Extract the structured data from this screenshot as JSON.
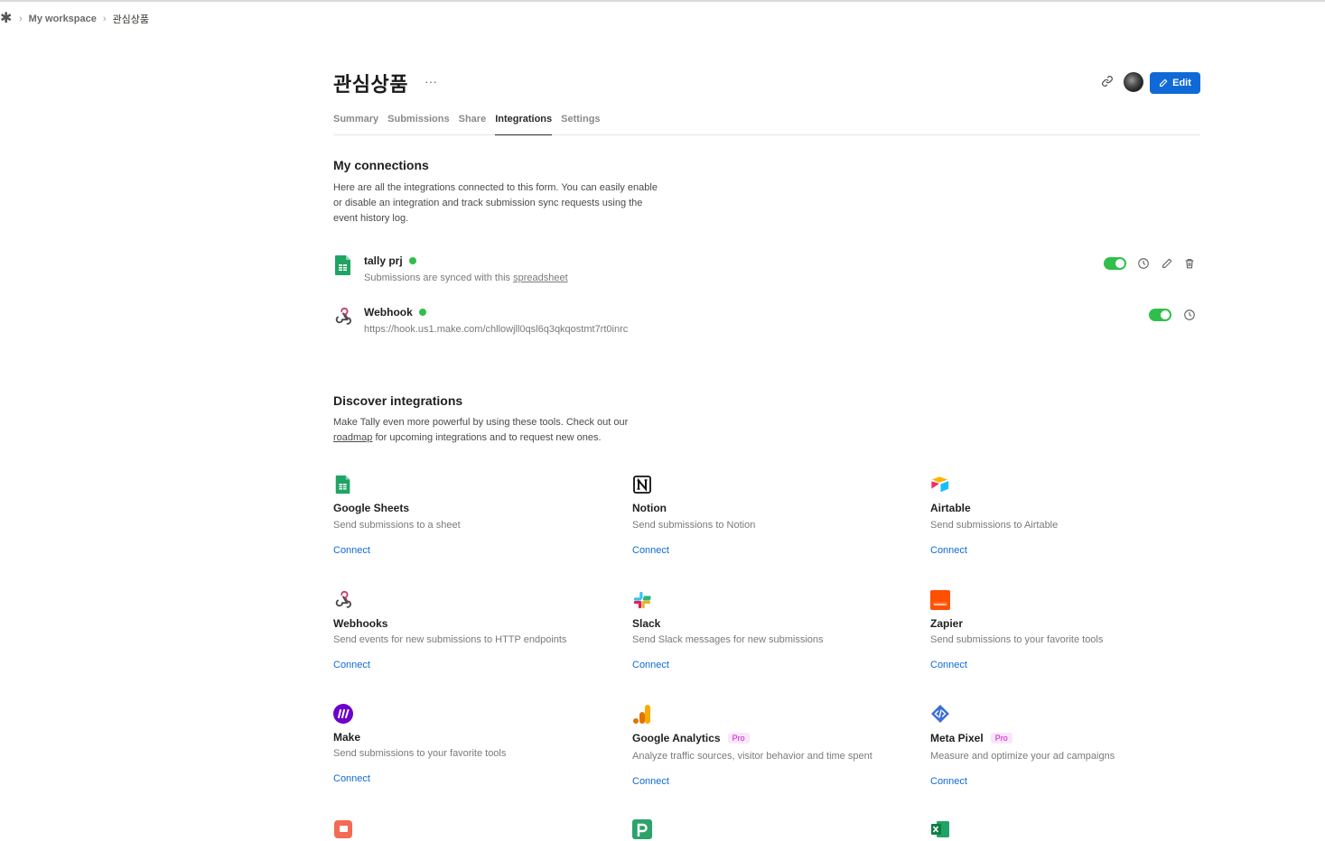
{
  "breadcrumb": {
    "workspace": "My workspace",
    "current": "관심상품"
  },
  "header": {
    "title": "관심상품",
    "more": "···",
    "edit_label": "Edit"
  },
  "tabs": [
    {
      "label": "Summary"
    },
    {
      "label": "Submissions"
    },
    {
      "label": "Share"
    },
    {
      "label": "Integrations",
      "active": true
    },
    {
      "label": "Settings"
    }
  ],
  "my_connections": {
    "title": "My connections",
    "desc_line1": "Here are all the integrations connected to this form. You can easily enable",
    "desc_line2": "or disable an integration and track submission sync requests using the",
    "desc_line3": "event history log.",
    "items": [
      {
        "name": "tally prj",
        "subtitle_prefix": "Submissions are synced with this ",
        "subtitle_link": "spreadsheet",
        "enabled": true,
        "icon": "google-sheets-icon"
      },
      {
        "name": "Webhook",
        "subtitle": "https://hook.us1.make.com/chllowjll0qsl6q3qkqostmt7rt0inrc",
        "enabled": true,
        "icon": "webhook-icon"
      }
    ]
  },
  "discover": {
    "title": "Discover integrations",
    "desc_line1": "Make Tally even more powerful by using these tools. Check out our",
    "desc_link": "roadmap",
    "desc_line2_rest": " for upcoming integrations and to request new ones.",
    "connect_label": "Connect",
    "pro_label": "Pro",
    "cards": [
      {
        "name": "Google Sheets",
        "desc": "Send submissions to a sheet",
        "icon": "google-sheets-icon"
      },
      {
        "name": "Notion",
        "desc": "Send submissions to Notion",
        "icon": "notion-icon"
      },
      {
        "name": "Airtable",
        "desc": "Send submissions to Airtable",
        "icon": "airtable-icon"
      },
      {
        "name": "Webhooks",
        "desc": "Send events for new submissions to HTTP endpoints",
        "icon": "webhook-icon"
      },
      {
        "name": "Slack",
        "desc": "Send Slack messages for new submissions",
        "icon": "slack-icon"
      },
      {
        "name": "Zapier",
        "desc": "Send submissions to your favorite tools",
        "icon": "zapier-icon"
      },
      {
        "name": "Make",
        "desc": "Send submissions to your favorite tools",
        "icon": "make-icon"
      },
      {
        "name": "Google Analytics",
        "desc": "Analyze traffic sources, visitor behavior and time spent",
        "icon": "google-analytics-icon",
        "pro": true
      },
      {
        "name": "Meta Pixel",
        "desc": "Measure and optimize your ad campaigns",
        "icon": "meta-pixel-icon",
        "pro": true
      }
    ],
    "partial_icons": [
      "coda-icon",
      "pipedream-icon",
      "excel-icon"
    ]
  },
  "colors": {
    "accent": "#0f6ad7",
    "toggle_on": "#2fbf4a",
    "pro_text": "#c01ac4",
    "pro_bg": "#fbe5fb"
  }
}
